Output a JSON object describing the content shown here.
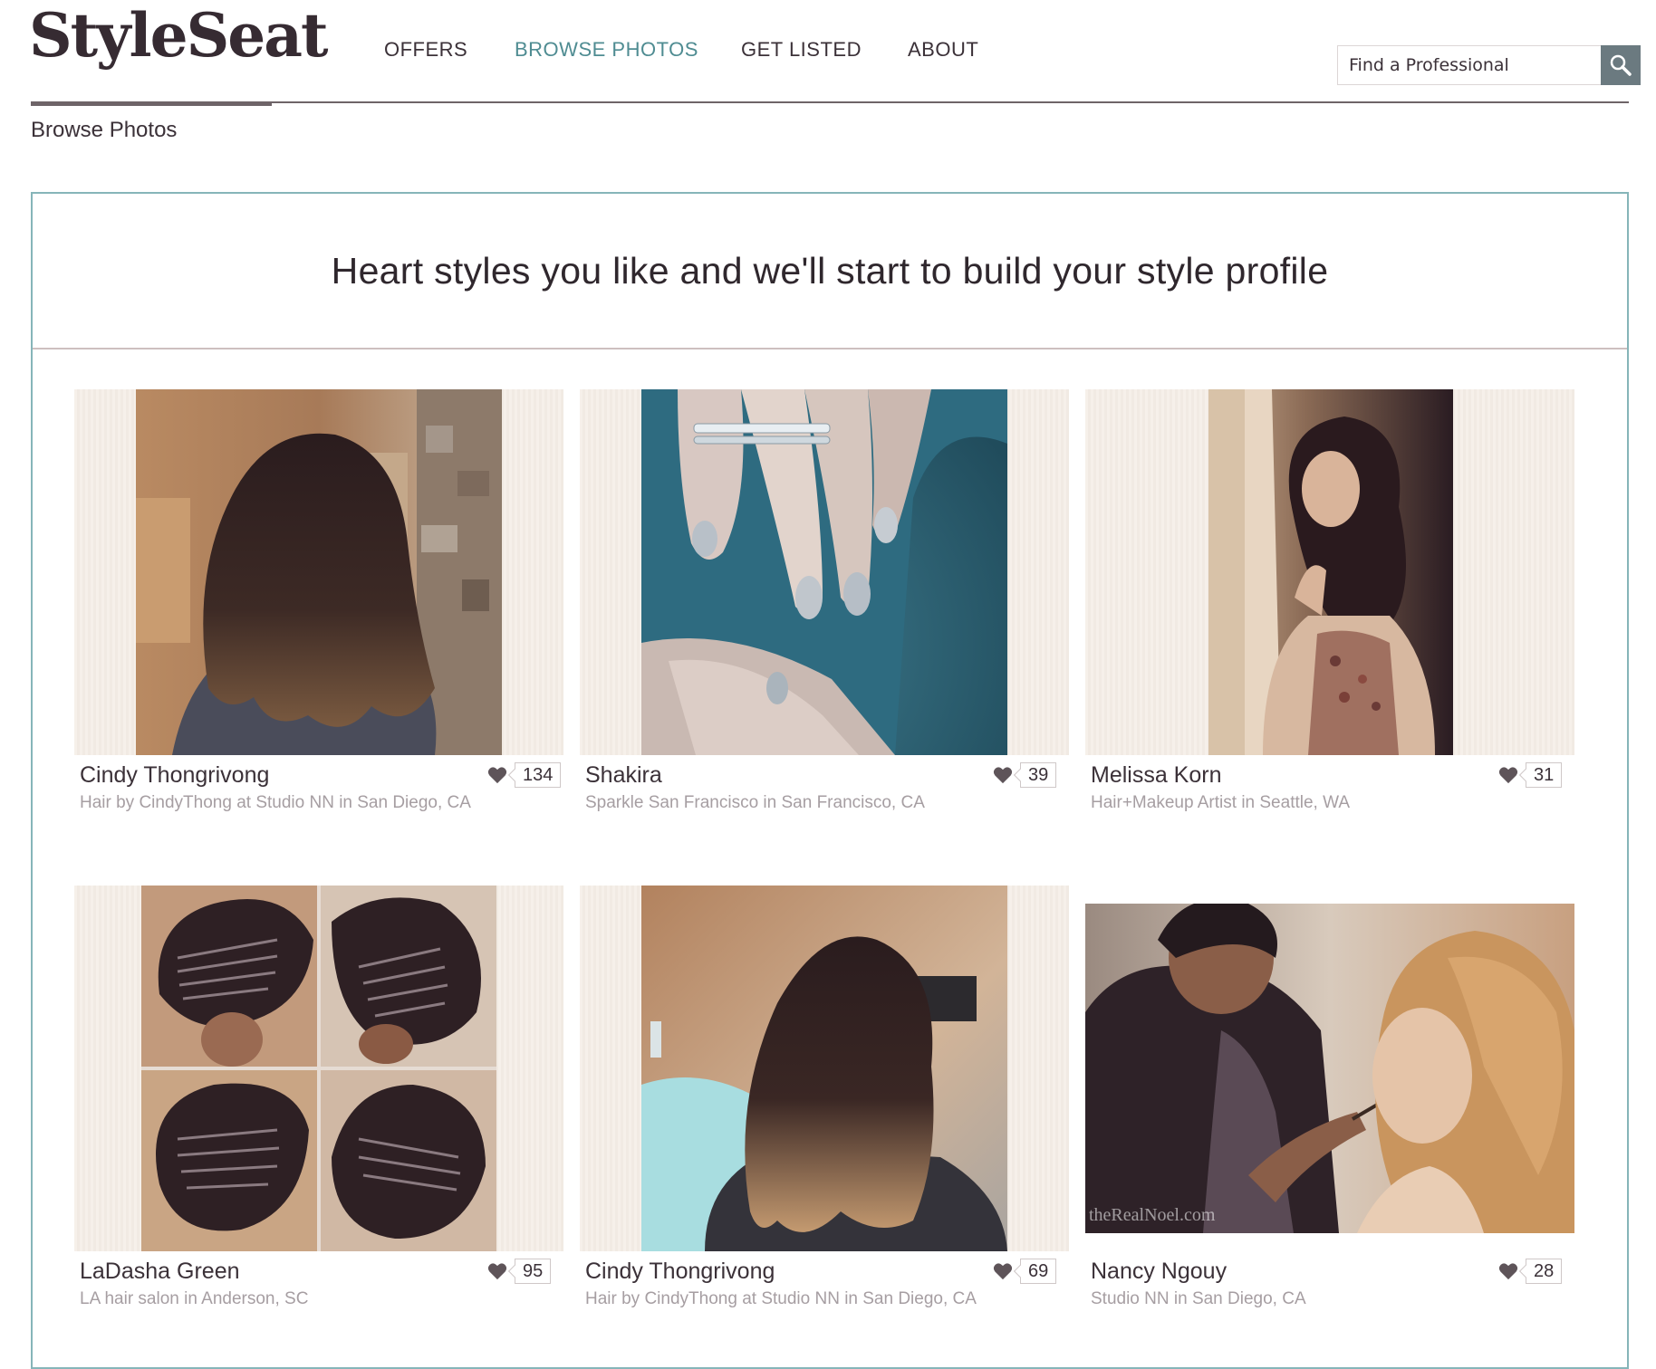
{
  "header": {
    "logo": "StyleSeat",
    "nav": [
      {
        "label": "OFFERS"
      },
      {
        "label": "BROWSE PHOTOS"
      },
      {
        "label": "GET LISTED"
      },
      {
        "label": "ABOUT"
      }
    ],
    "search": {
      "placeholder": "Find a Professional"
    }
  },
  "breadcrumb": "Browse Photos",
  "panel": {
    "title": "Heart styles you like and we'll start to build your style profile"
  },
  "cards": [
    {
      "name": "Cindy Thongrivong",
      "subtitle": "Hair by CindyThong at Studio NN in San Diego, CA",
      "likes": "134"
    },
    {
      "name": "Shakira",
      "subtitle": "Sparkle San Francisco in San Francisco, CA",
      "likes": "39"
    },
    {
      "name": "Melissa Korn",
      "subtitle": "Hair+Makeup Artist in Seattle, WA",
      "likes": "31"
    },
    {
      "name": "LaDasha Green",
      "subtitle": "LA hair salon in Anderson, SC",
      "likes": "95"
    },
    {
      "name": "Cindy Thongrivong",
      "subtitle": "Hair by CindyThong at Studio NN in San Diego, CA",
      "likes": "69"
    },
    {
      "name": "Nancy Ngouy",
      "subtitle": "Studio NN in San Diego, CA",
      "likes": "28",
      "watermark": "theRealNoel.com"
    }
  ],
  "colors": {
    "accent": "#4f8c92",
    "panel_border": "#86b5b9",
    "text": "#3b3138",
    "subtext": "#a69ea2"
  }
}
